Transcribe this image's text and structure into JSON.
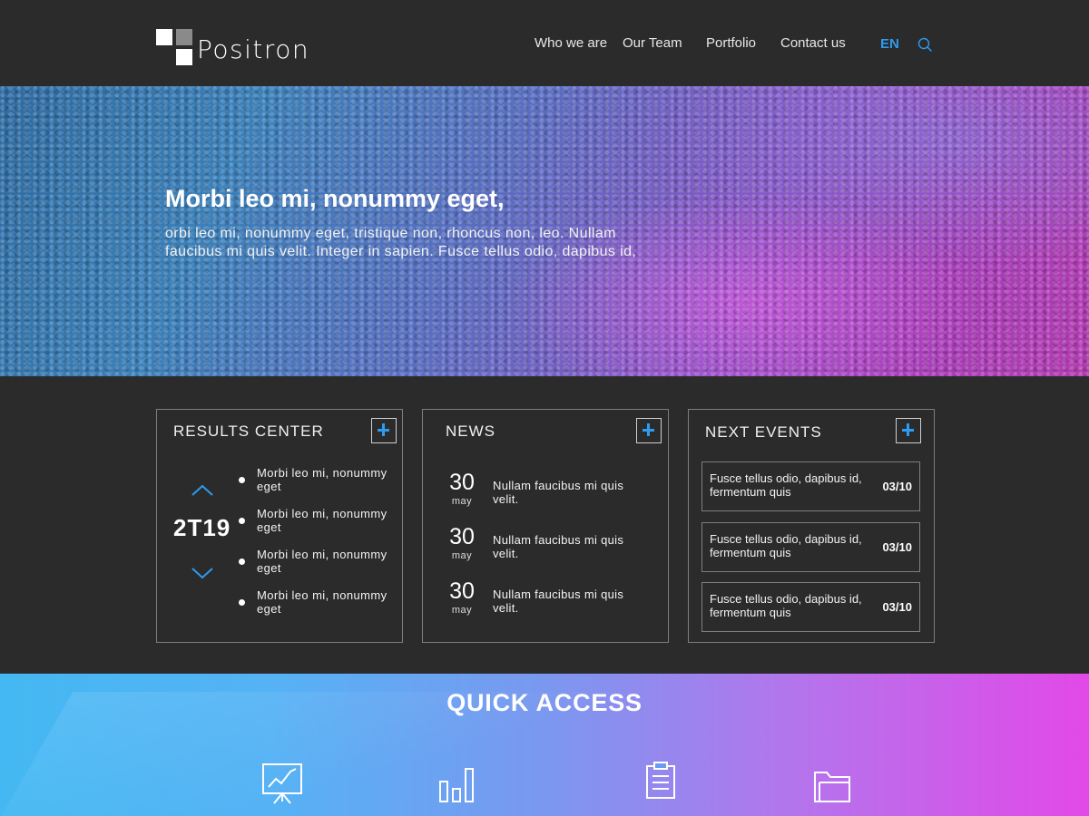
{
  "header": {
    "logo_text": "Positron",
    "nav": [
      "Who we are",
      "Our Team",
      "Portfolio",
      "Contact us"
    ],
    "language": "EN",
    "search_icon": "search-icon"
  },
  "hero": {
    "title": "Morbi leo mi, nonummy eget,",
    "text": "orbi leo mi, nonummy eget, tristique non, rhoncus non, leo. Nullam faucibus mi quis velit. Integer in sapien. Fusce tellus odio, dapibus id,"
  },
  "results_center": {
    "title": "RESULTS CENTER",
    "year": "2T19",
    "items": [
      "Morbi leo mi, nonummy eget",
      "Morbi leo mi, nonummy eget",
      "Morbi leo mi, nonummy eget",
      "Morbi leo mi, nonummy eget"
    ]
  },
  "news": {
    "title": "NEWS",
    "items": [
      {
        "day": "30",
        "month": "may",
        "text": "Nullam faucibus mi quis velit."
      },
      {
        "day": "30",
        "month": "may",
        "text": "Nullam faucibus mi quis velit."
      },
      {
        "day": "30",
        "month": "may",
        "text": "Nullam faucibus mi quis velit."
      }
    ]
  },
  "events": {
    "title": "NEXT EVENTS",
    "items": [
      {
        "text": "Fusce tellus odio, dapibus id, fermentum quis",
        "date": "03/10"
      },
      {
        "text": "Fusce tellus odio, dapibus id, fermentum quis",
        "date": "03/10"
      },
      {
        "text": "Fusce tellus odio, dapibus id, fermentum quis",
        "date": "03/10"
      }
    ]
  },
  "quick_access": {
    "title": "QUICK ACCESS",
    "icons": [
      "presentation-chart-icon",
      "bar-chart-icon",
      "clipboard-icon",
      "folder-icon"
    ]
  },
  "colors": {
    "accent": "#2d9bf0",
    "background": "#2b2b2b",
    "panel_border": "#7e7e7e"
  }
}
